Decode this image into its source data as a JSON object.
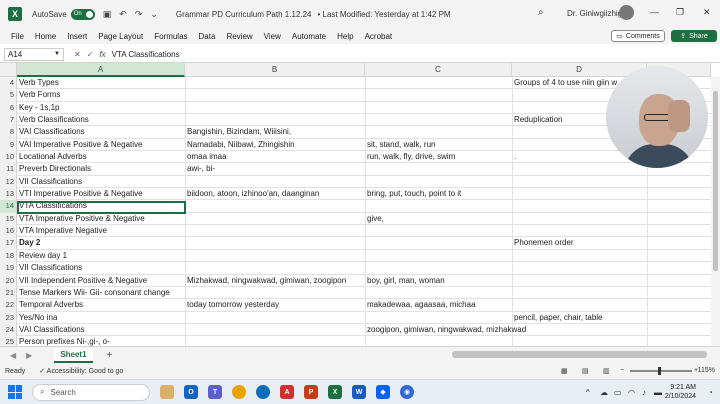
{
  "titlebar": {
    "autosave_label": "AutoSave",
    "autosave_state": "On",
    "doc_title": "Grammar PD Curriculum Path 1.12.24",
    "last_modified": "• Last Modified: Yesterday at 1:42 PM",
    "user_name": "Dr. Giniwgiizhig"
  },
  "menu": [
    "File",
    "Home",
    "Insert",
    "Page Layout",
    "Formulas",
    "Data",
    "Review",
    "View",
    "Automate",
    "Help",
    "Acrobat"
  ],
  "buttons": {
    "comments": "Comments",
    "share": "Share"
  },
  "formula_bar": {
    "name_box": "A14",
    "fx": "fx",
    "value": "VTA Classifications"
  },
  "columns": [
    "A",
    "B",
    "C",
    "D"
  ],
  "rows": [
    {
      "n": "4",
      "a": "Verb Types",
      "b": "",
      "c": "",
      "d": "Groups of 4 to use niin giin w"
    },
    {
      "n": "5",
      "a": "Verb Forms",
      "b": "",
      "c": "",
      "d": ""
    },
    {
      "n": "6",
      "a": "Key - 1s,1p",
      "b": "",
      "c": "",
      "d": ""
    },
    {
      "n": "7",
      "a": "Verb Classifications",
      "b": "",
      "c": "",
      "d": "Reduplication"
    },
    {
      "n": "8",
      "a": "VAI Classifications",
      "b": "Bangishin, Bizindam, Wiiisini,",
      "c": "",
      "d": ""
    },
    {
      "n": "9",
      "a": "VAI Imperative Positive & Negative",
      "b": "Namadabi, Niibawi, Zhingishin",
      "c": "sit, stand, walk, run",
      "d": ""
    },
    {
      "n": "10",
      "a": "Locational Adverbs",
      "b": "omaa imaa",
      "c": "run, walk, fly, drive, swim",
      "d": "."
    },
    {
      "n": "11",
      "a": "Preverb Directionals",
      "b": "awi-, bi-",
      "c": "",
      "d": ""
    },
    {
      "n": "12",
      "a": "VII Classifications",
      "b": "",
      "c": "",
      "d": ""
    },
    {
      "n": "13",
      "a": "VTI Imperative Positive & Negative",
      "b": "biidoon, atoon, izhinoo'an, daanginan",
      "c": "bring, put, touch, point to it",
      "d": ""
    },
    {
      "n": "14",
      "a": "VTA Classifications",
      "b": "",
      "c": "",
      "d": ""
    },
    {
      "n": "15",
      "a": "VTA Imperative Positive & Negative",
      "b": "",
      "c": "give,",
      "d": ""
    },
    {
      "n": "16",
      "a": "VTA Imperative Negative",
      "b": "",
      "c": "",
      "d": ""
    },
    {
      "n": "17",
      "a": "Day 2",
      "b": "",
      "c": "",
      "d": "Phonemen order"
    },
    {
      "n": "18",
      "a": "Review day 1",
      "b": "",
      "c": "",
      "d": ""
    },
    {
      "n": "19",
      "a": "VII Classifications",
      "b": "",
      "c": "",
      "d": ""
    },
    {
      "n": "20",
      "a": "VII Independent Positive & Negative",
      "b": "Mizhakwad, ningwakwad, gimiwan, zoogipon",
      "c": "boy, girl, man, woman",
      "d": ""
    },
    {
      "n": "21",
      "a": "Tense Markers Wii- Gii- consonant change",
      "b": "",
      "c": "",
      "d": ""
    },
    {
      "n": "22",
      "a": "Temporal Adverbs",
      "b": "today tomorrow yesterday",
      "c": "makadewaa, agaasaa, michaa",
      "d": ""
    },
    {
      "n": "23",
      "a": "Yes/No ina",
      "b": "",
      "c": "",
      "d": "pencil, paper, chair, table"
    },
    {
      "n": "24",
      "a": "VAI Classifications",
      "b": "",
      "c": "zoogipon, gimiwan, ningwakwad, mizhakwad",
      "d": ""
    },
    {
      "n": "25",
      "a": "Person prefixes Ni-,gi-, o-",
      "b": "",
      "c": "",
      "d": ""
    }
  ],
  "sheet_tab": "Sheet1",
  "status": {
    "ready": "Ready",
    "accessibility": "Accessibility: Good to go",
    "zoom": "115%"
  },
  "taskbar": {
    "search_placeholder": "Search",
    "time": "9:21 AM",
    "date": "2/10/2024"
  }
}
